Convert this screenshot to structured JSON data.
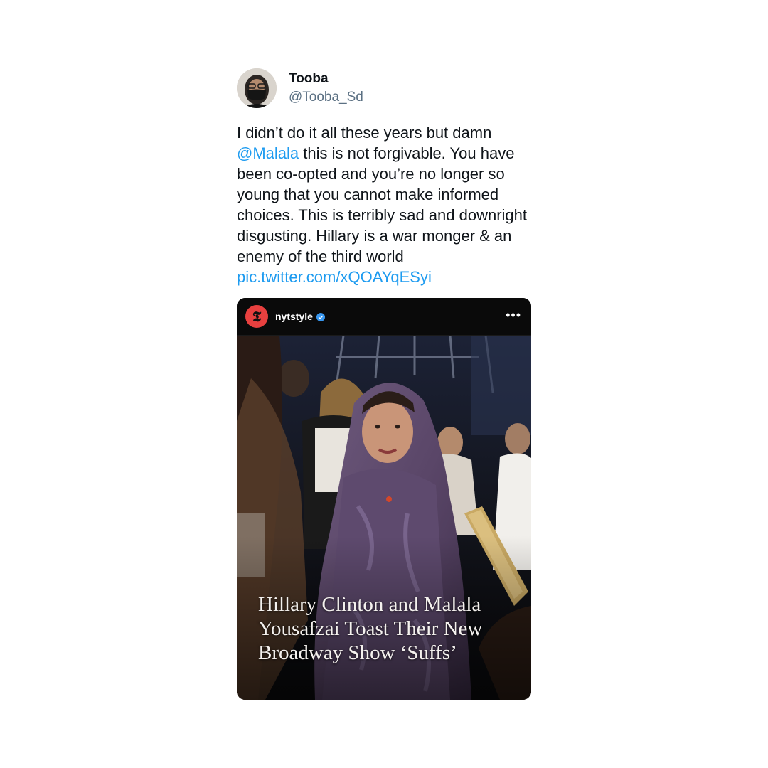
{
  "tweet": {
    "display_name": "Tooba",
    "handle": "@Tooba_Sd",
    "text_part1": "I didn’t do it all these years but damn ",
    "mention": "@Malala",
    "text_part2": " this is not forgivable. You have been co-opted and you’re no longer so young that you cannot make informed choices. This is terribly sad and downright disgusting. Hillary is a war monger & an enemy of the third world ",
    "pic_link": "pic.twitter.com/xQOAYqESyi"
  },
  "media": {
    "account_name": "nytstyle",
    "logo_glyph": "𝕿",
    "more_glyph": "•••",
    "headline": "Hillary Clinton and Malala Yousafzai Toast Their New Broadway Show ‘Suffs’"
  },
  "colors": {
    "link": "#1d9bf0",
    "handle": "#5b7083",
    "nyt_badge": "#e8403f",
    "verified": "#3897f0"
  },
  "icons": {
    "verified": "verified-badge-icon",
    "more": "more-options-icon"
  }
}
